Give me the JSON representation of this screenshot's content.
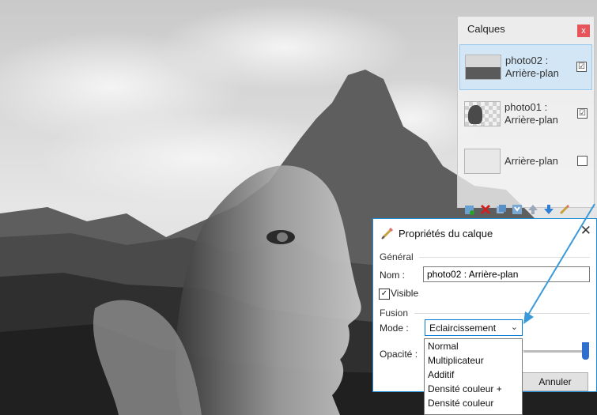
{
  "layers_panel": {
    "title": "Calques",
    "close_label": "x",
    "layers": [
      {
        "name_line1": "photo02 :",
        "name_line2": "Arrière-plan",
        "visible_mark": "☑",
        "selected": true
      },
      {
        "name_line1": "photo01 :",
        "name_line2": "Arrière-plan",
        "visible_mark": "☑",
        "selected": false
      },
      {
        "name_line1": "Arrière-plan",
        "name_line2": "",
        "visible_mark": "",
        "selected": false
      }
    ],
    "toolbar_icons": [
      "add-layer-icon",
      "delete-layer-icon",
      "duplicate-layer-icon",
      "merge-down-icon",
      "move-up-icon",
      "move-down-icon",
      "layer-properties-icon"
    ]
  },
  "props_dialog": {
    "title": "Propriétés du calque",
    "close_label": "✕",
    "general_label": "Général",
    "name_label": "Nom :",
    "name_value": "photo02 : Arrière-plan",
    "visible_label": "Visible",
    "visible_checked": true,
    "fusion_label": "Fusion",
    "mode_label": "Mode :",
    "mode_value": "Eclaircissement",
    "opacity_label": "Opacité :",
    "opacity_value": 1.0,
    "cancel_label": "Annuler",
    "mode_options": [
      "Normal",
      "Multiplicateur",
      "Additif",
      "Densité couleur +",
      "Densité couleur"
    ]
  },
  "colors": {
    "accent": "#0078d7",
    "arrow": "#3a9ad9",
    "close_red": "#e5555a"
  }
}
